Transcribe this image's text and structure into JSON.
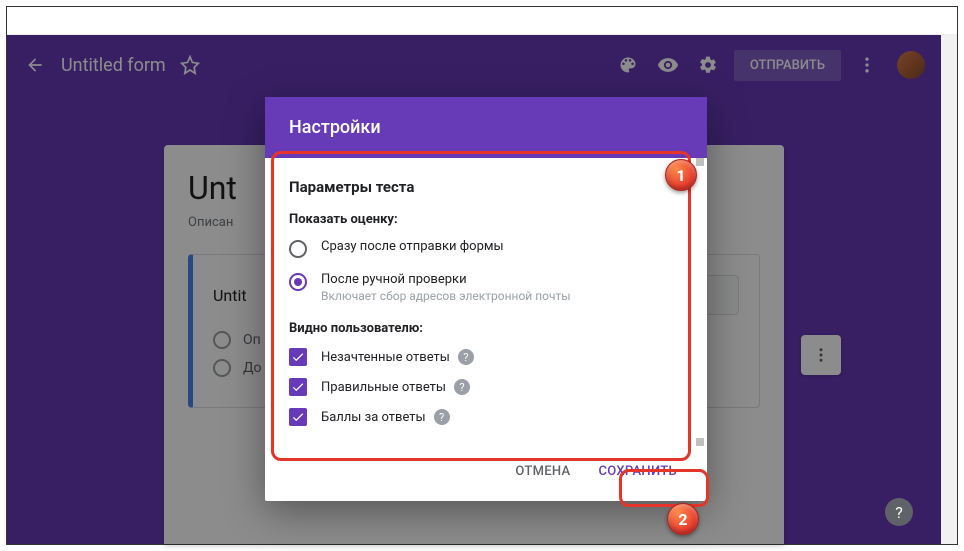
{
  "header": {
    "form_title": "Untitled form",
    "send_label": "ОТПРАВИТЬ"
  },
  "form": {
    "title_truncated": "Unt",
    "description_label": "Описан",
    "question_title": "Untit",
    "option1_prefix": "Оп",
    "option2_prefix": "До"
  },
  "dialog": {
    "title": "Настройки",
    "section_title": "Параметры теста",
    "show_grade_heading": "Показать оценку:",
    "radio_immediate": "Сразу после отправки формы",
    "radio_manual": "После ручной проверки",
    "radio_manual_sub": "Включает сбор адресов электронной почты",
    "visible_heading": "Видно пользователю:",
    "chk_wrong": "Незачтенные ответы",
    "chk_correct": "Правильные ответы",
    "chk_points": "Баллы за ответы",
    "cancel_label": "ОТМЕНА",
    "save_label": "СОХРАНИТЬ"
  },
  "markers": {
    "m1": "1",
    "m2": "2"
  }
}
